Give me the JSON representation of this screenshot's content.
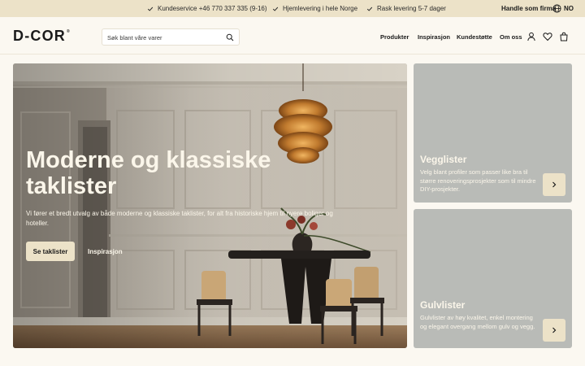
{
  "topbar": {
    "usps": [
      {
        "icon": "check-icon",
        "label": "Kundeservice +46 770 337 335 (9-16)"
      },
      {
        "icon": "check-icon",
        "label": "Hjemlevering i hele Norge"
      },
      {
        "icon": "check-icon",
        "label": "Rask levering 5-7 dager"
      }
    ],
    "business_link": "Handle som firma",
    "language": {
      "icon": "globe-icon",
      "label": "NO"
    }
  },
  "header": {
    "logo": "D-COR",
    "logo_mark": "®",
    "search": {
      "placeholder": "Søk blant våre varer",
      "value": "",
      "icon": "search-icon"
    },
    "nav": [
      "Produkter",
      "Inspirasjon",
      "Kundestøtte",
      "Om oss"
    ],
    "icons": [
      "user-icon",
      "heart-icon",
      "bag-icon"
    ]
  },
  "hero": {
    "title": "Moderne og klassiske taklister",
    "text": "Vi fører et bredt utvalg av både moderne og klassiske taklister, for alt fra historiske hjem til nyere boliger og hoteller.",
    "primary_button": "Se taklister",
    "secondary_link": "Inspirasjon"
  },
  "cards": [
    {
      "title": "Vegglister",
      "text": "Velg blant profiler som passer like bra til større renoveringsprosjekter som til mindre DIY-prosjekter.",
      "icon": "chevron-right-icon"
    },
    {
      "title": "Gulvlister",
      "text": "Gulvlister av høy kvalitet, enkel montering og elegant overgang mellom gulv og vegg.",
      "icon": "chevron-right-icon"
    }
  ],
  "colors": {
    "page_bg": "#fbf8f1",
    "topbar_bg": "#ece2c8",
    "accent_button": "#ece2c8",
    "card_bg": "#b9bbb7",
    "text_dark": "#1b1b1b",
    "text_light": "#fbf6ea"
  }
}
